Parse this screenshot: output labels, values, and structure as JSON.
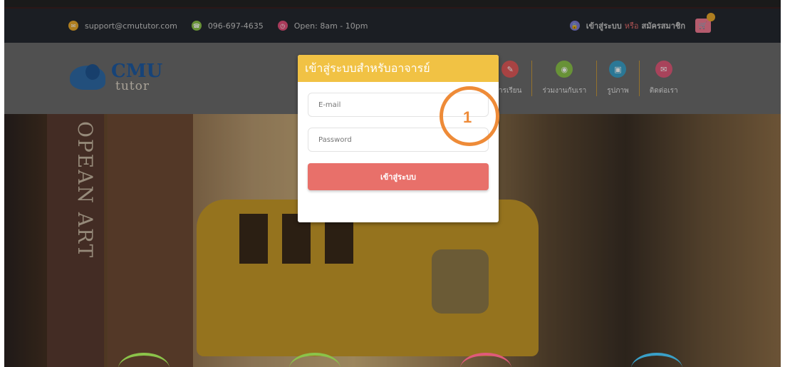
{
  "topbar": {
    "email": "support@cmututor.com",
    "phone": "096-697-4635",
    "hours": "Open: 8am - 10pm",
    "login_link": "เข้าสู่ระบบ",
    "or_text": "หรือ",
    "register_link": "สมัครสมาชิก",
    "colors": {
      "email_icon": "#e9a82b",
      "phone_icon": "#8bc34a",
      "hours_icon": "#e04f7a",
      "login_icon": "#7b7bd4"
    }
  },
  "logo": {
    "cmu": "CMU",
    "tutor": "tutor"
  },
  "nav": {
    "items": [
      {
        "label": "ารเรียน",
        "icon_color": "#e05a5a",
        "icon": "pencil-icon"
      },
      {
        "label": "ร่วมงานกับเรา",
        "icon_color": "#8bc34a",
        "icon": "eye-icon"
      },
      {
        "label": "รูปภาพ",
        "icon_color": "#3aa0c8",
        "icon": "image-icon"
      },
      {
        "label": "ติดต่อเรา",
        "icon_color": "#e05a7a",
        "icon": "mail-icon"
      }
    ]
  },
  "hero": {
    "book_title": "OPEAN ART"
  },
  "modal": {
    "title": "เข้าสู่ระบบสำหรับอาจารย์",
    "email_placeholder": "E-mail",
    "password_placeholder": "Password",
    "login_button": "เข้าสู่ระบบ",
    "header_color": "#f1c244",
    "button_color": "#e8706a"
  },
  "annotation": {
    "number": "1",
    "color": "#ee8b38"
  }
}
